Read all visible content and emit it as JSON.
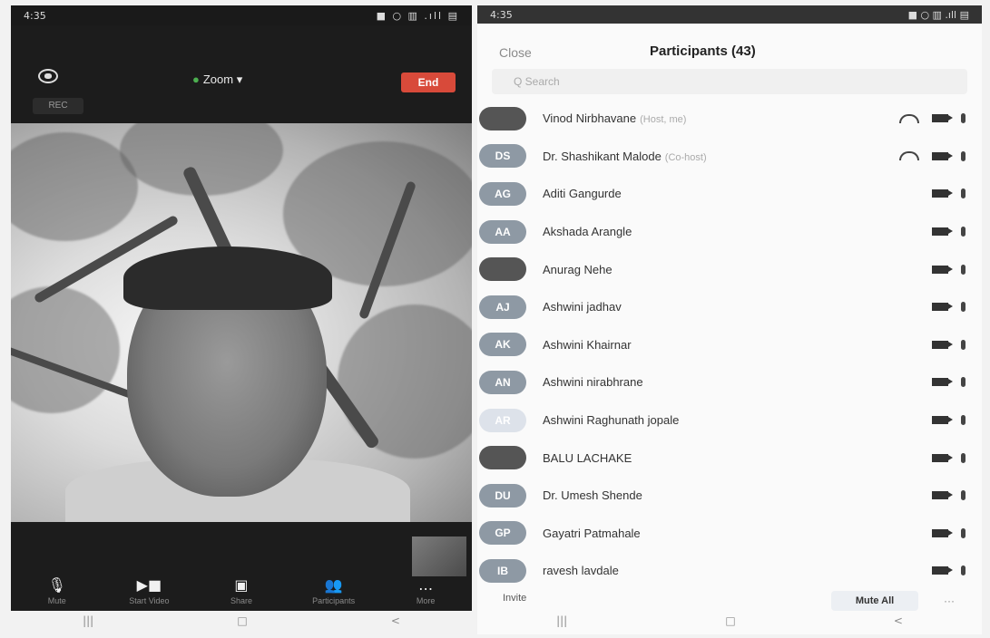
{
  "left": {
    "status_time": "4:35",
    "status_right": "■ ○ ▥ .ıll ▤",
    "rec_label": "REC",
    "meeting_title": "Zoom",
    "meeting_title_caret": "▾",
    "end_label": "End",
    "toolbar": [
      {
        "name": "mute",
        "icon": "microphone-icon",
        "glyph": "🎙",
        "label": "Mute"
      },
      {
        "name": "start-video",
        "icon": "video-camera-icon",
        "glyph": "▶■",
        "label": "Start Video"
      },
      {
        "name": "share",
        "icon": "share-screen-icon",
        "glyph": "▣",
        "label": "Share"
      },
      {
        "name": "participants",
        "icon": "participants-icon",
        "glyph": "👥",
        "label": "Participants"
      },
      {
        "name": "more",
        "icon": "more-icon",
        "glyph": "…",
        "label": "More"
      }
    ],
    "nav": [
      "|||",
      "□",
      "<"
    ]
  },
  "right": {
    "status_time": "4:35",
    "status_right": "■ ○ ▥ .ıll ▤",
    "close_label": "Close",
    "title": "Participants (43)",
    "search_placeholder": "Q  Search",
    "participants": [
      {
        "initials": "",
        "avatar_style": "dark",
        "name": "Vinod Nirbhavane",
        "tag": "(Host, me)",
        "share": true
      },
      {
        "initials": "DS",
        "avatar_style": "",
        "name": "Dr. Shashikant Malode",
        "tag": "(Co-host)",
        "share": true
      },
      {
        "initials": "AG",
        "avatar_style": "",
        "name": "Aditi Gangurde",
        "tag": "",
        "share": false
      },
      {
        "initials": "AA",
        "avatar_style": "",
        "name": "Akshada Arangle",
        "tag": "",
        "share": false
      },
      {
        "initials": "",
        "avatar_style": "dark",
        "name": "Anurag Nehe",
        "tag": "",
        "share": false
      },
      {
        "initials": "AJ",
        "avatar_style": "",
        "name": "Ashwini jadhav",
        "tag": "",
        "share": false
      },
      {
        "initials": "AK",
        "avatar_style": "",
        "name": "Ashwini Khairnar",
        "tag": "",
        "share": false
      },
      {
        "initials": "AN",
        "avatar_style": "",
        "name": "Ashwini nirabhrane",
        "tag": "",
        "share": false
      },
      {
        "initials": "AR",
        "avatar_style": "pale",
        "name": "Ashwini Raghunath jopale",
        "tag": "",
        "share": false
      },
      {
        "initials": "",
        "avatar_style": "dark",
        "name": "BALU LACHAKE",
        "tag": "",
        "share": false
      },
      {
        "initials": "DU",
        "avatar_style": "",
        "name": "Dr. Umesh Shende",
        "tag": "",
        "share": false
      },
      {
        "initials": "GP",
        "avatar_style": "",
        "name": "Gayatri Patmahale",
        "tag": "",
        "share": false
      },
      {
        "initials": "IB",
        "avatar_style": "",
        "name": "ravesh lavdale",
        "tag": "",
        "share": false
      }
    ],
    "invite_label": "Invite",
    "mute_all_label": "Mute All",
    "more_label": "···",
    "nav": [
      "|||",
      "□",
      "<"
    ]
  }
}
